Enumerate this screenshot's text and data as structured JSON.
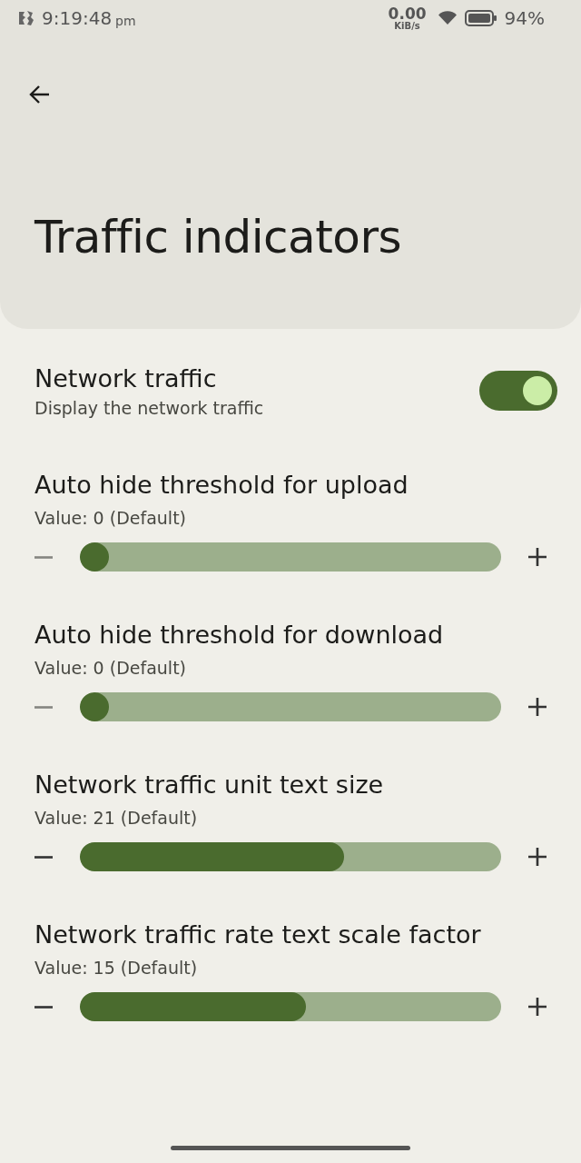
{
  "status_bar": {
    "time": "9:19:48",
    "ampm": "pm",
    "speed_value": "0.00",
    "speed_unit": "KiB/s",
    "battery": "94%"
  },
  "header": {
    "title": "Traffic indicators"
  },
  "switch_setting": {
    "title": "Network traffic",
    "summary": "Display the network traffic",
    "on": true
  },
  "sliders": [
    {
      "title": "Auto hide threshold for upload",
      "value": "Value: 0 (Default)",
      "level": 0,
      "decrease_disabled": true
    },
    {
      "title": "Auto hide threshold for download",
      "value": "Value: 0 (Default)",
      "level": 0,
      "decrease_disabled": true
    },
    {
      "title": "Network traffic unit text size",
      "value": "Value: 21 (Default)",
      "level": 0.627,
      "decrease_disabled": false
    },
    {
      "title": "Network traffic rate text scale factor",
      "value": "Value: 15 (Default)",
      "level": 0.536,
      "decrease_disabled": false
    }
  ]
}
